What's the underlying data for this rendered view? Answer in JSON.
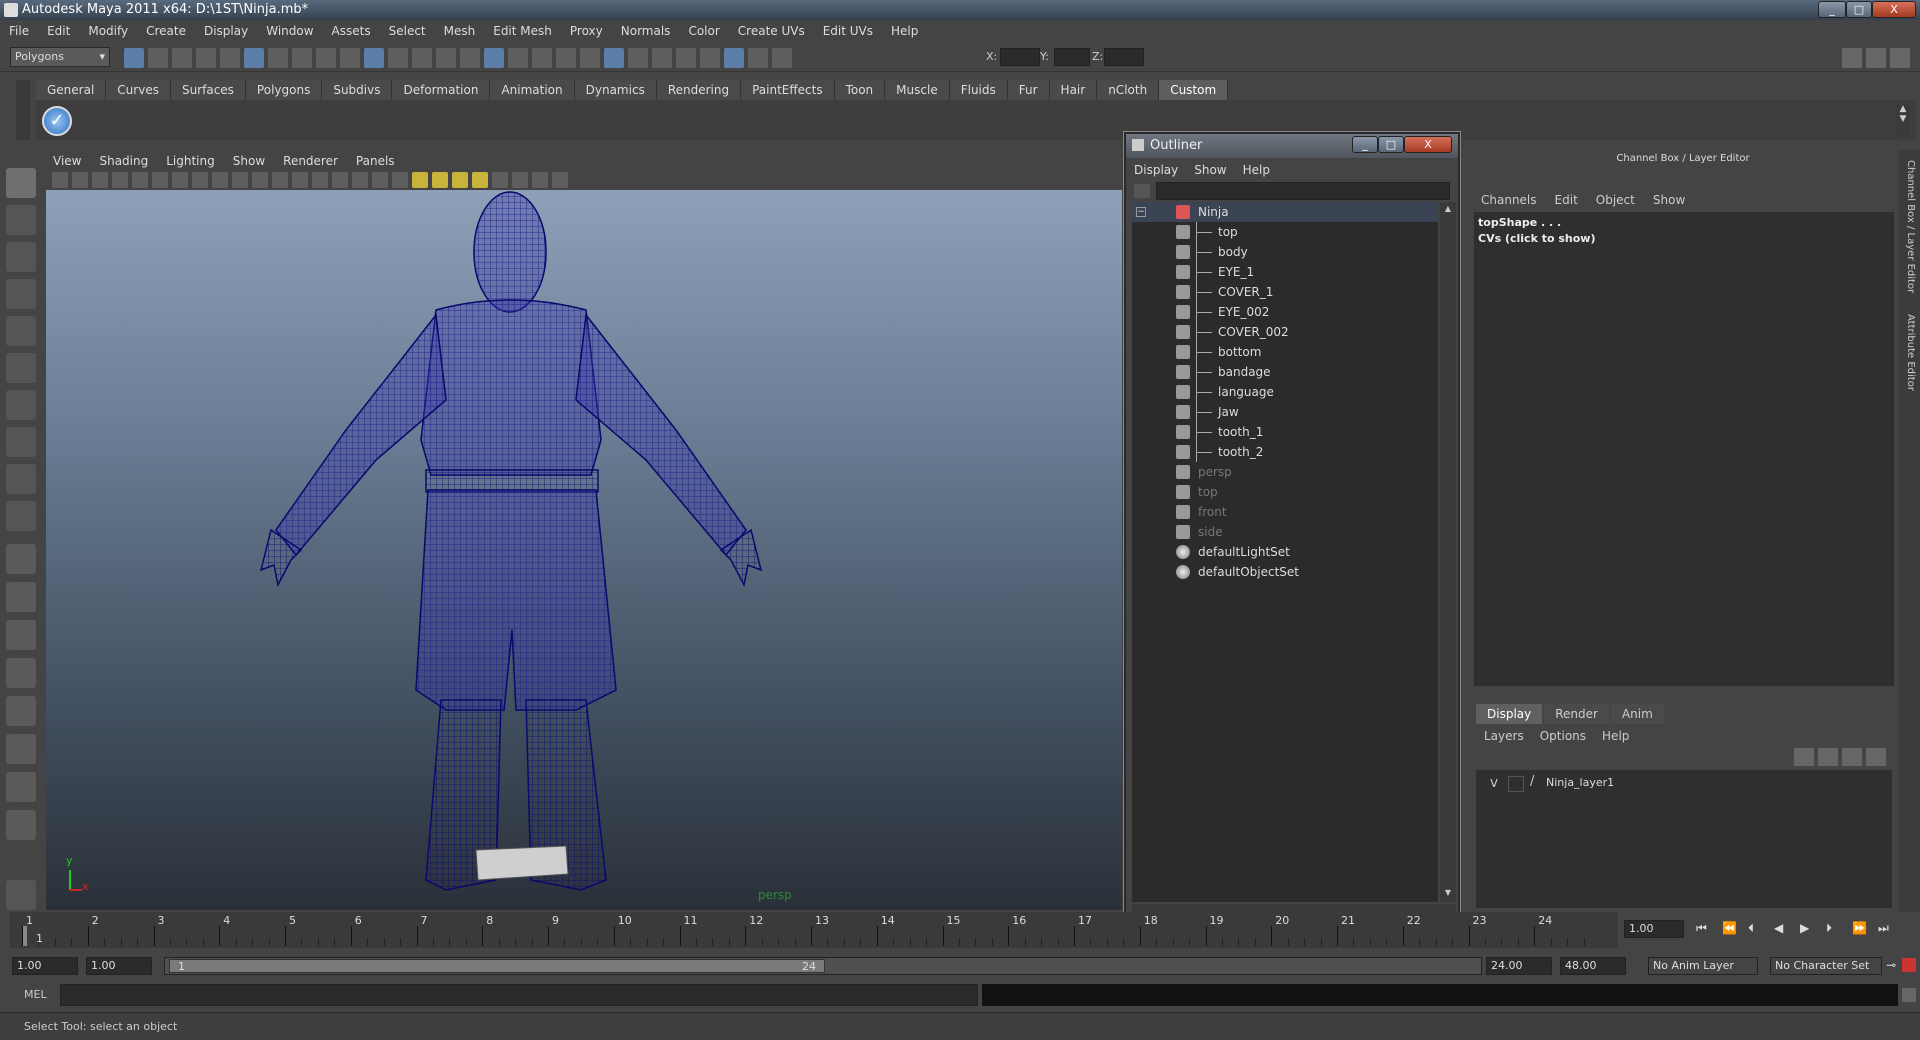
{
  "window": {
    "title": "Autodesk Maya 2011 x64: D:\\1ST\\Ninja.mb*",
    "minimize": "_",
    "maximize": "□",
    "close": "X"
  },
  "menubar": [
    "File",
    "Edit",
    "Modify",
    "Create",
    "Display",
    "Window",
    "Assets",
    "Select",
    "Mesh",
    "Edit Mesh",
    "Proxy",
    "Normals",
    "Color",
    "Create UVs",
    "Edit UVs",
    "Help"
  ],
  "statusline": {
    "mode": "Polygons",
    "x_label": "X:",
    "y_label": "Y:",
    "z_label": "Z:"
  },
  "shelf_tabs": [
    "General",
    "Curves",
    "Surfaces",
    "Polygons",
    "Subdivs",
    "Deformation",
    "Animation",
    "Dynamics",
    "Rendering",
    "PaintEffects",
    "Toon",
    "Muscle",
    "Fluids",
    "Fur",
    "Hair",
    "nCloth",
    "Custom"
  ],
  "active_shelf": "Custom",
  "viewport": {
    "menu": [
      "View",
      "Shading",
      "Lighting",
      "Show",
      "Renderer",
      "Panels"
    ],
    "camera_label": "persp",
    "axis_x": "x",
    "axis_y": "y"
  },
  "outliner": {
    "title": "Outliner",
    "menu": [
      "Display",
      "Show",
      "Help"
    ],
    "items": [
      {
        "label": "Ninja",
        "indent": 0,
        "dim": false,
        "expanded": true,
        "icon": "group-icon"
      },
      {
        "label": "top",
        "indent": 1,
        "dim": false,
        "icon": "mesh-icon"
      },
      {
        "label": "body",
        "indent": 1,
        "dim": false,
        "icon": "mesh-icon"
      },
      {
        "label": "EYE_1",
        "indent": 1,
        "dim": false,
        "icon": "mesh-icon"
      },
      {
        "label": "COVER_1",
        "indent": 1,
        "dim": false,
        "icon": "mesh-icon"
      },
      {
        "label": "EYE_002",
        "indent": 1,
        "dim": false,
        "icon": "mesh-icon"
      },
      {
        "label": "COVER_002",
        "indent": 1,
        "dim": false,
        "icon": "mesh-icon"
      },
      {
        "label": "bottom",
        "indent": 1,
        "dim": false,
        "icon": "mesh-icon"
      },
      {
        "label": "bandage",
        "indent": 1,
        "dim": false,
        "icon": "mesh-icon"
      },
      {
        "label": "language",
        "indent": 1,
        "dim": false,
        "icon": "mesh-icon"
      },
      {
        "label": "Jaw",
        "indent": 1,
        "dim": false,
        "icon": "mesh-icon"
      },
      {
        "label": "tooth_1",
        "indent": 1,
        "dim": false,
        "icon": "mesh-icon"
      },
      {
        "label": "tooth_2",
        "indent": 1,
        "dim": false,
        "icon": "mesh-icon"
      },
      {
        "label": "persp",
        "indent": 0,
        "dim": true,
        "icon": "camera-icon"
      },
      {
        "label": "top",
        "indent": 0,
        "dim": true,
        "icon": "camera-icon"
      },
      {
        "label": "front",
        "indent": 0,
        "dim": true,
        "icon": "camera-icon"
      },
      {
        "label": "side",
        "indent": 0,
        "dim": true,
        "icon": "camera-icon"
      },
      {
        "label": "defaultLightSet",
        "indent": 0,
        "dim": false,
        "icon": "set-icon"
      },
      {
        "label": "defaultObjectSet",
        "indent": 0,
        "dim": false,
        "icon": "set-icon"
      }
    ]
  },
  "channelbox": {
    "title": "Channel Box / Layer Editor",
    "menu": [
      "Channels",
      "Edit",
      "Object",
      "Show"
    ],
    "node": "topShape . . .",
    "cvs": "CVs (click to show)"
  },
  "side_tabs": [
    "Channel Box / Layer Editor",
    "Attribute Editor"
  ],
  "layers": {
    "tabs": [
      "Display",
      "Render",
      "Anim"
    ],
    "active_tab": "Display",
    "menu": [
      "Layers",
      "Options",
      "Help"
    ],
    "rows": [
      {
        "visible": "V",
        "name": "Ninja_layer1"
      }
    ]
  },
  "timeline": {
    "ticks": [
      "1",
      "2",
      "3",
      "4",
      "5",
      "6",
      "7",
      "8",
      "9",
      "10",
      "11",
      "12",
      "13",
      "14",
      "15",
      "16",
      "17",
      "18",
      "19",
      "20",
      "21",
      "22",
      "23",
      "24"
    ],
    "current_frame": "1",
    "current_field": "1.00"
  },
  "range": {
    "start": "1.00",
    "playback_start": "1.00",
    "slider_start": "1",
    "slider_end": "24",
    "playback_end": "24.00",
    "end": "48.00",
    "anim_layer": "No Anim Layer",
    "character_set": "No Character Set"
  },
  "cmdline": {
    "label": "MEL"
  },
  "helpline": {
    "text": "Select Tool: select an object"
  }
}
